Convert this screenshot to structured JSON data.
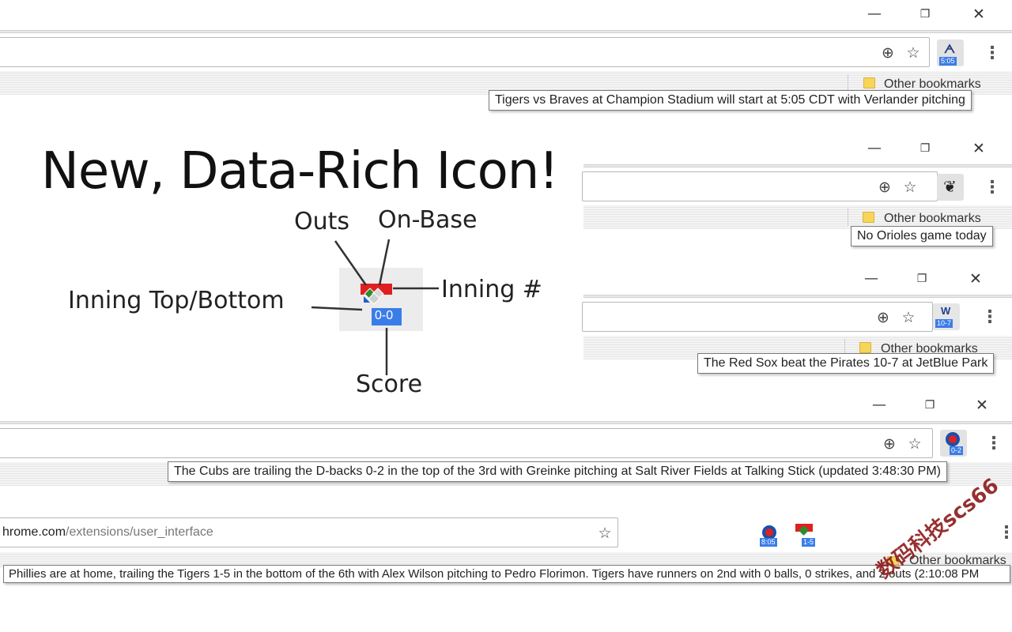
{
  "window_controls": {
    "minimize": "—",
    "restore": "❐",
    "close": "✕"
  },
  "panel1": {
    "badge": "5:05",
    "bookmark_label": "Other bookmarks",
    "tooltip": "Tigers vs Braves at Champion Stadium will start at 5:05 CDT with Verlander pitching"
  },
  "panel2": {
    "bookmark_label": "Other bookmarks",
    "tooltip": "No Orioles game today"
  },
  "panel3": {
    "icon_letter": "W",
    "badge": "10-7",
    "bookmark_label": "Other bookmarks",
    "tooltip": "The Red Sox beat the Pirates 10-7 at JetBlue Park"
  },
  "panel4": {
    "badge": "0-2",
    "tooltip": "The Cubs are trailing the D-backs 0-2 in the top of the 3rd with Greinke pitching at Salt River Fields at Talking Stick (updated 3:48:30 PM)"
  },
  "panel5": {
    "url_host": "hrome.com",
    "url_path": "/extensions/user_interface",
    "badge_a": "8:05",
    "badge_b": "1-5",
    "bookmark_label": "Other bookmarks",
    "tooltip": "Phillies are at home, trailing the Tigers 1-5 in the bottom of the 6th with Alex Wilson pitching to Pedro Florimon. Tigers have runners on 2nd with 0 balls, 0 strikes, and 2 outs (2:10:08 PM"
  },
  "diagram": {
    "headline": "New, Data-Rich Icon!",
    "label_outs": "Outs",
    "label_onbase": "On-Base",
    "label_inning_num": "Inning #",
    "label_inning_tb": "Inning Top/Bottom",
    "label_score": "Score",
    "icon_score": "0-0"
  },
  "watermark": "数码科技scs66",
  "colors": {
    "badge_blue": "#3b7de8",
    "diamond_red": "#e02020",
    "diamond_green": "#2e8b2e"
  }
}
